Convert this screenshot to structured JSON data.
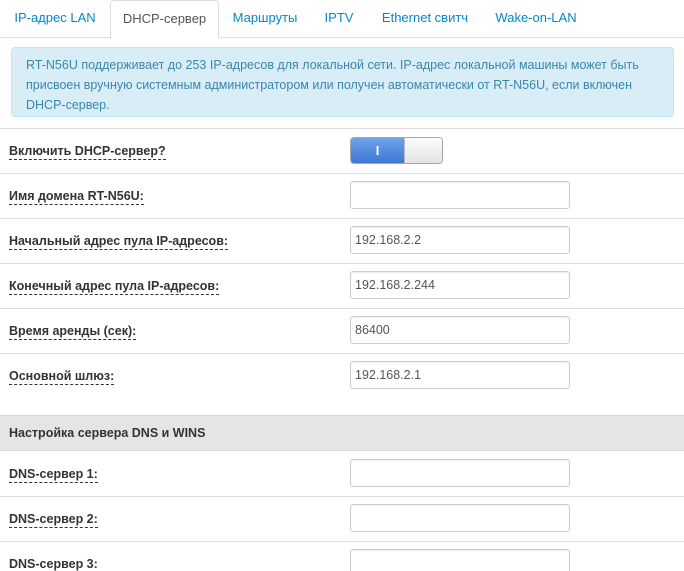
{
  "tabs": [
    {
      "label": "IP-адрес LAN",
      "active": false
    },
    {
      "label": "DHCP-сервер",
      "active": true
    },
    {
      "label": "Маршруты",
      "active": false
    },
    {
      "label": "IPTV",
      "active": false
    },
    {
      "label": "Ethernet свитч",
      "active": false
    },
    {
      "label": "Wake-on-LAN",
      "active": false
    }
  ],
  "alert": {
    "text": "RT-N56U поддерживает до 253 IP-адресов для локальной сети. IP-адрес локальной машины может быть присвоен вручную системным администратором или получен автоматически от RT-N56U, если включен DHCP-сервер."
  },
  "form": {
    "dhcp_enable": {
      "label": "Включить DHCP-сервер?",
      "toggle_text": "I",
      "state": "on"
    },
    "domain_name": {
      "label": "Имя домена RT-N56U:",
      "value": ""
    },
    "pool_start": {
      "label": "Начальный адрес пула IP-адресов:",
      "value": "192.168.2.2"
    },
    "pool_end": {
      "label": "Конечный адрес пула IP-адресов:",
      "value": "192.168.2.244"
    },
    "lease_time": {
      "label": "Время аренды (сек):",
      "value": "86400"
    },
    "gateway": {
      "label": "Основной шлюз:",
      "value": "192.168.2.1"
    }
  },
  "dns_section": {
    "title": "Настройка сервера DNS и WINS",
    "dns1": {
      "label": "DNS-сервер 1:",
      "value": ""
    },
    "dns2": {
      "label": "DNS-сервер 2:",
      "value": ""
    },
    "dns3": {
      "label": "DNS-сервер 3:",
      "value": ""
    }
  },
  "colors": {
    "link": "#0088cc",
    "alert_bg": "#d9edf7",
    "alert_text": "#3a87ad",
    "toggle_on": "#3e78d6",
    "section_bg": "#e5e5e5"
  }
}
